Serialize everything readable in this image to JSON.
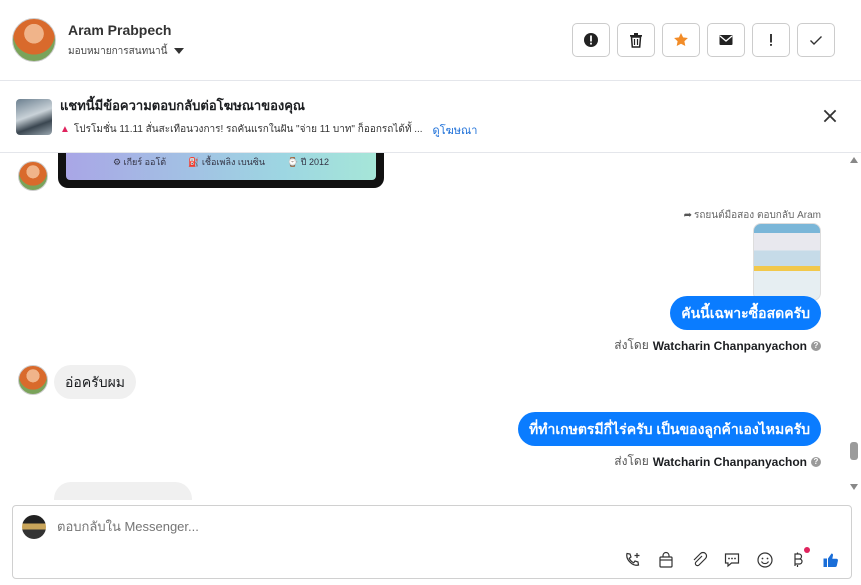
{
  "header": {
    "name": "Aram Prabpech",
    "assign_label": "มอบหมายการสนทนานี้",
    "actions": [
      "spam-alert",
      "delete",
      "star",
      "mark-unread",
      "important",
      "done"
    ]
  },
  "banner": {
    "title": "แชทนี้มีข้อความตอบกลับต่อโฆษณาของคุณ",
    "ad_text": "โปรโมชั่น 11.11 สั่นสะเทือนวงการ! รถคันแรกในฝัน \"จ่าย 11 บาท\" ก็ออกรถได้ทั้ ...",
    "link": "ดูโฆษณา"
  },
  "messages": {
    "phone_card": {
      "item1": "เกียร์ ออโต้",
      "item2": "เชื้อเพลิง เบนซิน",
      "item3": "ปี 2012"
    },
    "reply_note": "รถยนต์มือสอง ตอบกลับ Aram",
    "msg1": "คันนี้เฉพาะซื้อสดครับ",
    "sent_by_prefix": "ส่งโดย",
    "sent_by_name": "Watcharin Chanpanyachon",
    "msg2": "อ่อครับผม",
    "msg3": "ที่ทำเกษตรมีกี่ไร่ครับ เป็นของลูกค้าเองไหมครับ"
  },
  "composer": {
    "placeholder": "ตอบกลับใน Messenger..."
  },
  "colors": {
    "outgoing_bubble": "#0a7cff",
    "incoming_bubble": "#f0f0f0",
    "star": "#f28c28",
    "like": "#1a6ed8"
  }
}
